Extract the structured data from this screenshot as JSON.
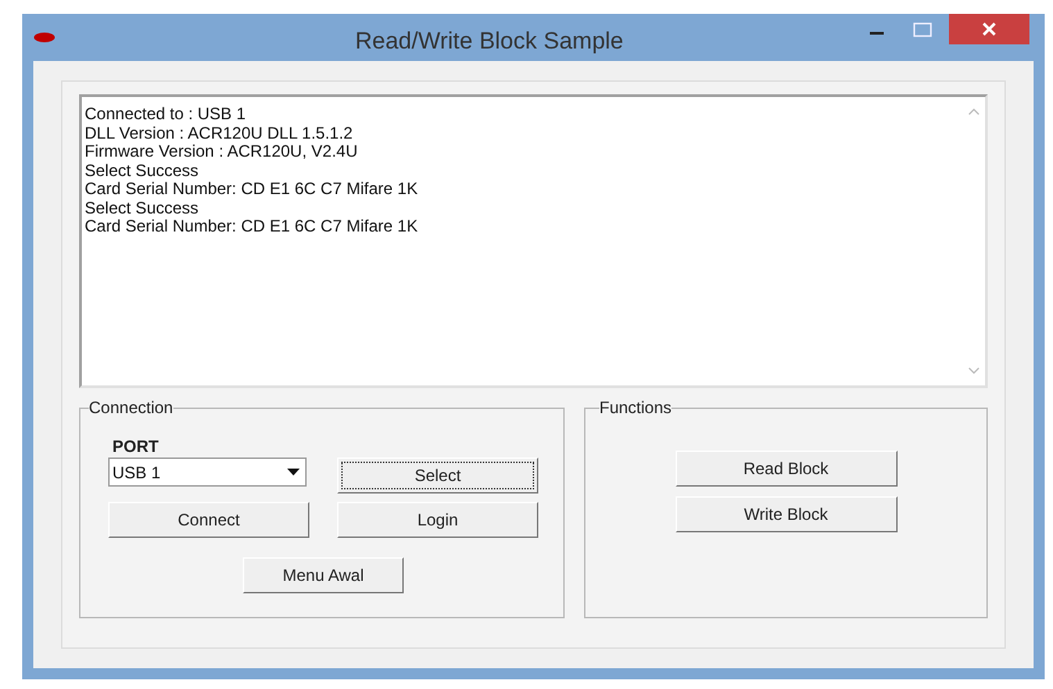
{
  "window": {
    "title": "Read/Write Block Sample"
  },
  "log": [
    "Connected to : USB 1",
    "DLL Version : ACR120U DLL 1.5.1.2",
    "Firmware Version  : ACR120U, V2.4U",
    "Select Success",
    "Card Serial Number: CD E1 6C C7 Mifare 1K",
    "Select Success",
    "Card Serial Number: CD E1 6C C7 Mifare 1K"
  ],
  "connection": {
    "title": "Connection",
    "port_label": "PORT",
    "port_value": "USB 1",
    "buttons": [
      {
        "label": "Select",
        "focused": true
      },
      {
        "label": "Connect",
        "focused": false
      },
      {
        "label": "Login",
        "focused": false
      },
      {
        "label": "Menu Awal",
        "focused": false
      }
    ]
  },
  "functions": {
    "title": "Functions",
    "buttons": [
      {
        "label": "Read Block",
        "focused": false
      },
      {
        "label": "Write Block",
        "focused": false
      }
    ]
  }
}
